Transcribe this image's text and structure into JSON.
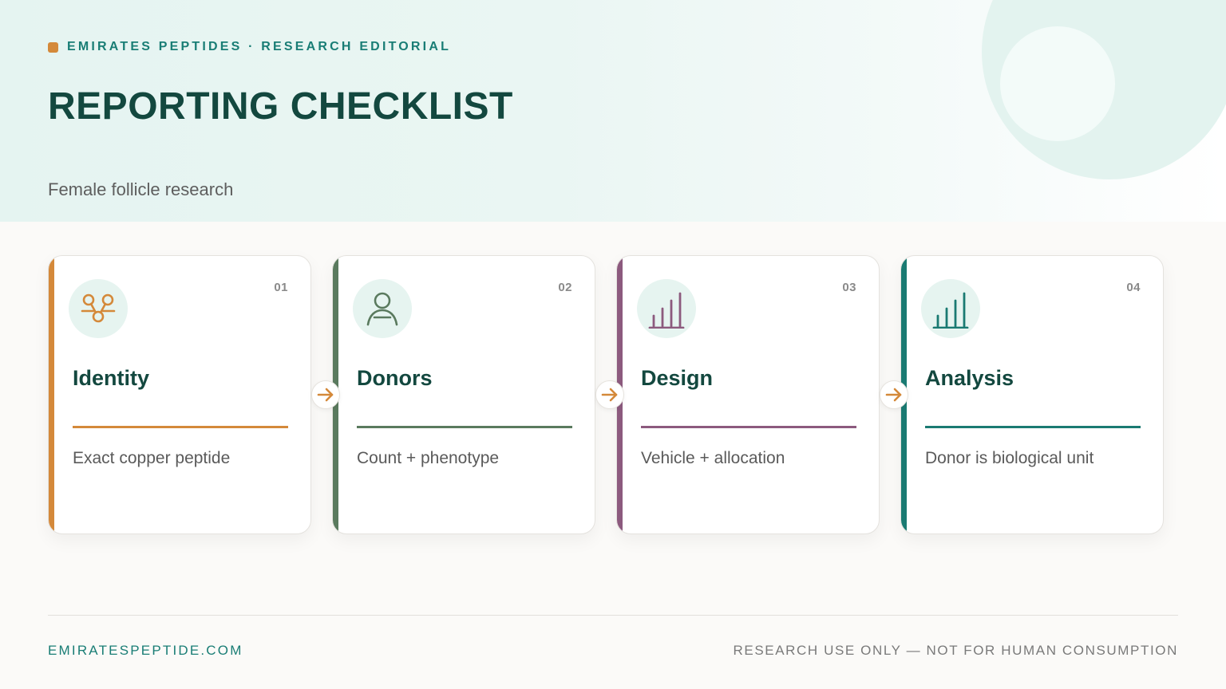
{
  "brand": {
    "label": "EMIRATES PEPTIDES · RESEARCH EDITORIAL",
    "accent_color": "#d4893a",
    "text_color": "#197d75"
  },
  "header": {
    "title": "REPORTING CHECKLIST",
    "subtitle": "Female follicle research"
  },
  "cards": [
    {
      "num": "01",
      "title": "Identity",
      "desc": "Exact copper peptide",
      "color": "#d4893a",
      "icon": "molecule-icon"
    },
    {
      "num": "02",
      "title": "Donors",
      "desc": "Count + phenotype",
      "color": "#5a7a5e",
      "icon": "person-icon"
    },
    {
      "num": "03",
      "title": "Design",
      "desc": "Vehicle + allocation",
      "color": "#8c5a7e",
      "icon": "bar-chart-icon"
    },
    {
      "num": "04",
      "title": "Analysis",
      "desc": "Donor is biological unit",
      "color": "#1a7a72",
      "icon": "bar-chart-icon"
    }
  ],
  "connectors": {
    "icon": "arrow-right-icon",
    "color": "#d4893a"
  },
  "footer": {
    "website": "EMIRATESPEPTIDE.COM",
    "disclaimer": "RESEARCH USE ONLY — NOT FOR HUMAN CONSUMPTION"
  }
}
